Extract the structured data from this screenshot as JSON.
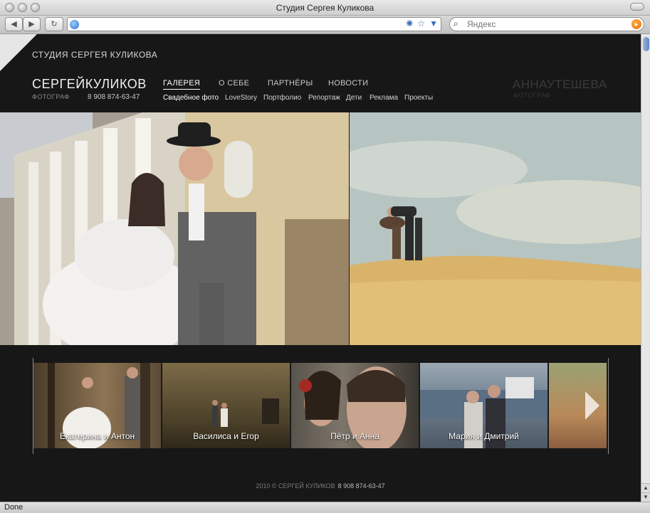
{
  "window": {
    "title": "Студия Сергея Куликова"
  },
  "toolbar": {
    "back_label": "◀",
    "forward_label": "▶",
    "reload_label": "↻",
    "search_placeholder": "Яндекс"
  },
  "status": {
    "text": "Done"
  },
  "site": {
    "studio_title": "СТУДИЯ СЕРГЕЯ КУЛИКОВА",
    "brand_first": "СЕРГЕЙ",
    "brand_last": "КУЛИКОВ",
    "brand_role": "ФОТОГРАФ",
    "phone": "8 908 874-63-47",
    "menu": [
      "ГАЛЕРЕЯ",
      "О СЕБЕ",
      "ПАРТНЁРЫ",
      "НОВОСТИ"
    ],
    "submenu": [
      "Свадебное фото",
      "LoveStory",
      "Портфолио",
      "Репортаж",
      "Дети",
      "Реклама",
      "Проекты"
    ],
    "partner_first": "АННА",
    "partner_last": "УТЕШЕВА",
    "partner_role": "ФОТОГРАФ"
  },
  "gallery": {
    "items": [
      "Екатерина и Антон",
      "Василиса и Егор",
      "Пётр и Анна",
      "Мария и Дмитрий"
    ]
  },
  "footer": {
    "copyright": "2010 © СЕРГЕЙ КУЛИКОВ",
    "phone": "8 908 874-63-47"
  },
  "colors": {
    "page_bg": "#171717",
    "menu_active": "#ffffff",
    "accent_orange": "#e56d0b"
  }
}
